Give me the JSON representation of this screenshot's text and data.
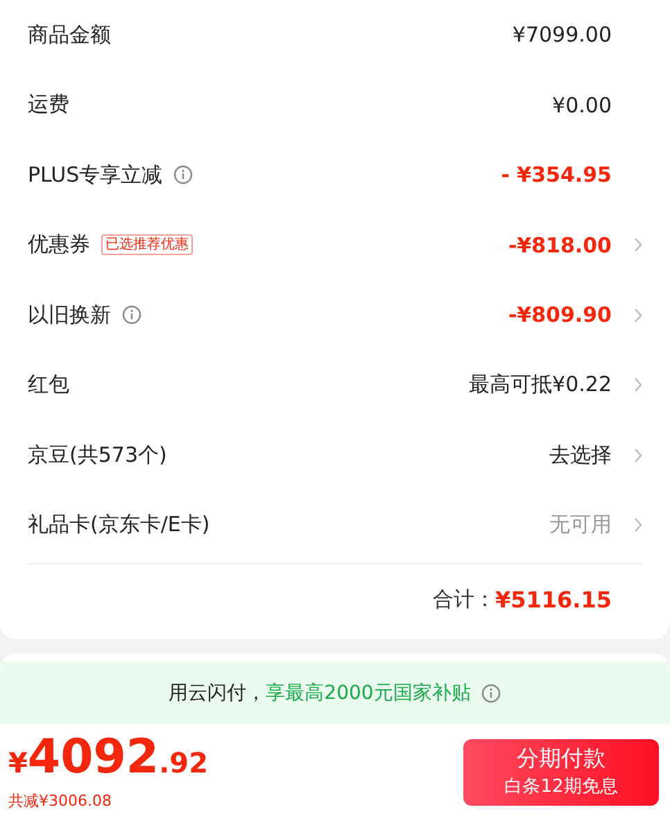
{
  "rows": [
    {
      "label": "商品金额",
      "info": false,
      "value": "¥7099.00",
      "kind": "dark",
      "arrow": false
    },
    {
      "label": "运费",
      "info": false,
      "value": "¥0.00",
      "kind": "dark",
      "arrow": false
    },
    {
      "label": "PLUS专享立减",
      "info": true,
      "value": "- ¥354.95",
      "kind": "red",
      "arrow": false
    },
    {
      "label": "优惠券",
      "info": false,
      "tag": "已选推荐优惠",
      "value": "-¥818.00",
      "kind": "red",
      "arrow": true
    },
    {
      "label": "以旧换新",
      "info": true,
      "value": "-¥809.90",
      "kind": "red",
      "arrow": true
    },
    {
      "label": "红包",
      "info": false,
      "value": "最高可抵¥0.22",
      "kind": "dark",
      "arrow": true
    },
    {
      "label": "京豆(共573个)",
      "info": false,
      "value": "去选择",
      "kind": "dark",
      "arrow": true
    },
    {
      "label": "礼品卡(京东卡/E卡)",
      "info": false,
      "value": "无可用",
      "kind": "grey",
      "arrow": true
    }
  ],
  "total": {
    "label": "合计：",
    "value": "¥5116.15"
  },
  "banner": {
    "text": "用云闪付，",
    "highlight": "享最高2000元国家补贴"
  },
  "price": {
    "symbol": "¥",
    "integer": "4092",
    "decimal": ".92",
    "saved": "共减¥3006.08"
  },
  "pay_button": {
    "title": "分期付款",
    "subtitle": "白条12期免息"
  }
}
